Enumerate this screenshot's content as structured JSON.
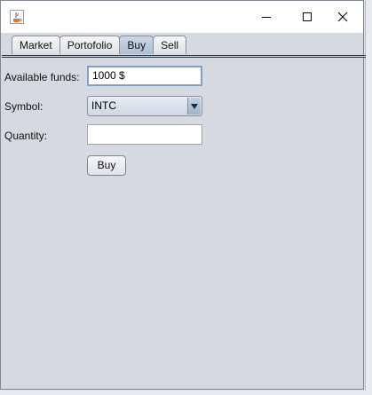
{
  "window": {
    "title": "",
    "icon": "java-cup-icon"
  },
  "tabs": [
    {
      "label": "Market",
      "selected": false
    },
    {
      "label": "Portofolio",
      "selected": false
    },
    {
      "label": "Buy",
      "selected": true
    },
    {
      "label": "Sell",
      "selected": false
    }
  ],
  "form": {
    "funds_label": "Available funds:",
    "funds_value": "1000 $",
    "symbol_label": "Symbol:",
    "symbol_value": "INTC",
    "quantity_label": "Quantity:",
    "quantity_value": "",
    "buy_label": "Buy"
  },
  "colors": {
    "panel": "#d6d9df",
    "selected_tab": "#aebfd3",
    "focus_border": "#7ea2c8"
  }
}
